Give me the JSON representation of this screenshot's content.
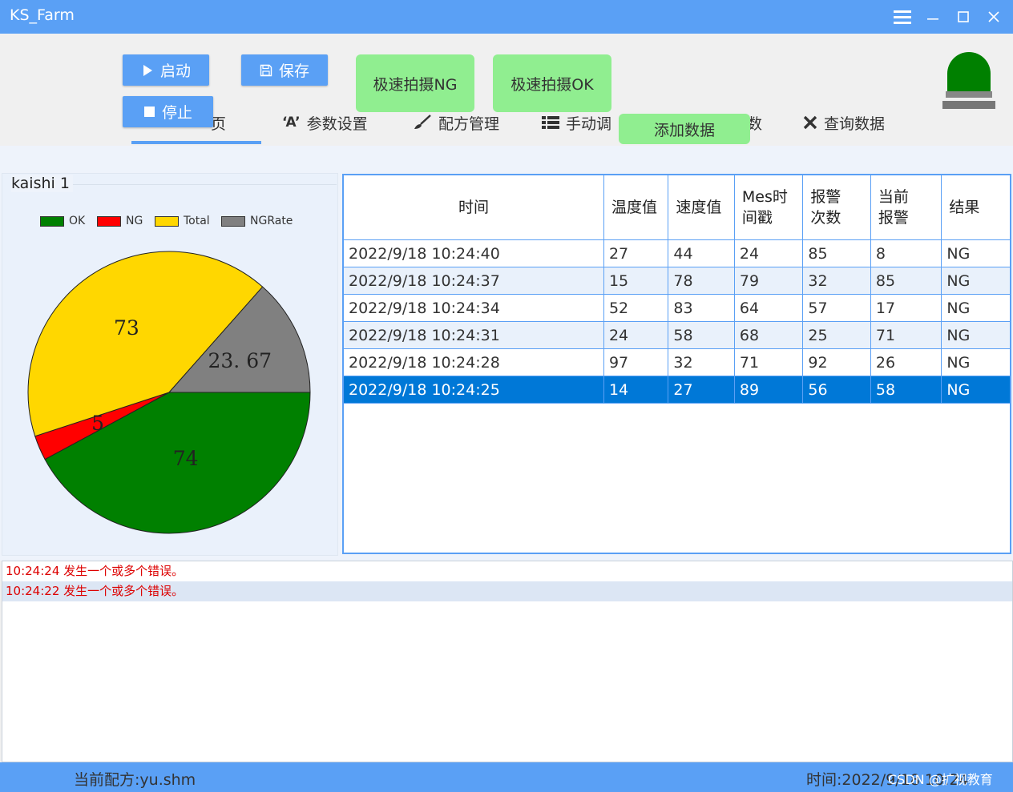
{
  "window": {
    "title": "KS_Farm"
  },
  "toolbar": {
    "start_label": "启动",
    "save_label": "保存",
    "stop_label": "停止",
    "snap_ng_label": "极速拍摄NG",
    "snap_ok_label": "极速拍摄OK",
    "add_data_label": "添加数据"
  },
  "nav": {
    "home_fragment": "页",
    "params": "参数设置",
    "recipe": "配方管理",
    "manual_fragment": "手动调",
    "hidden_fragment": "数",
    "query": "查询数据"
  },
  "chart_data": {
    "type": "pie",
    "title": "kaishi 1",
    "legend": [
      "OK",
      "NG",
      "Total",
      "NGRate"
    ],
    "legend_position": "top",
    "colors": [
      "#008000",
      "#ff0000",
      "#ffd700",
      "#808080"
    ],
    "values": [
      74,
      5,
      73,
      23.67
    ],
    "labels": [
      "74",
      "5",
      "73",
      "23. 67"
    ]
  },
  "table": {
    "columns": [
      "时间",
      "温度值",
      "速度值",
      "Mes时间戳",
      "报警次数",
      "当前报警",
      "结果"
    ],
    "column_display": [
      [
        "时间"
      ],
      [
        "温度值"
      ],
      [
        "速度值"
      ],
      [
        "Mes时",
        "间戳"
      ],
      [
        "报警",
        "次数"
      ],
      [
        "当前",
        "报警"
      ],
      [
        "结果"
      ]
    ],
    "rows": [
      [
        "2022/9/18 10:24:40",
        "27",
        "44",
        "24",
        "85",
        "8",
        "NG"
      ],
      [
        "2022/9/18 10:24:37",
        "15",
        "78",
        "79",
        "32",
        "85",
        "NG"
      ],
      [
        "2022/9/18 10:24:34",
        "52",
        "83",
        "64",
        "57",
        "17",
        "NG"
      ],
      [
        "2022/9/18 10:24:31",
        "24",
        "58",
        "68",
        "25",
        "71",
        "NG"
      ],
      [
        "2022/9/18 10:24:28",
        "97",
        "32",
        "71",
        "92",
        "26",
        "NG"
      ],
      [
        "2022/9/18 10:24:25",
        "14",
        "27",
        "89",
        "56",
        "58",
        "NG"
      ]
    ],
    "selected_row": 5
  },
  "log": [
    "10:24:24 发生一个或多个错误。",
    "10:24:22 发生一个或多个错误。"
  ],
  "status": {
    "recipe": "当前配方:yu.shm",
    "time": "时间:2022/9/18 10:24"
  },
  "watermark": "CSDN @扩视教育",
  "colors": {
    "accent": "#5aa0f5",
    "green_button": "#90ee90",
    "lamp": "#008000",
    "selected_row": "#0078d7",
    "error_text": "#dd0000"
  }
}
